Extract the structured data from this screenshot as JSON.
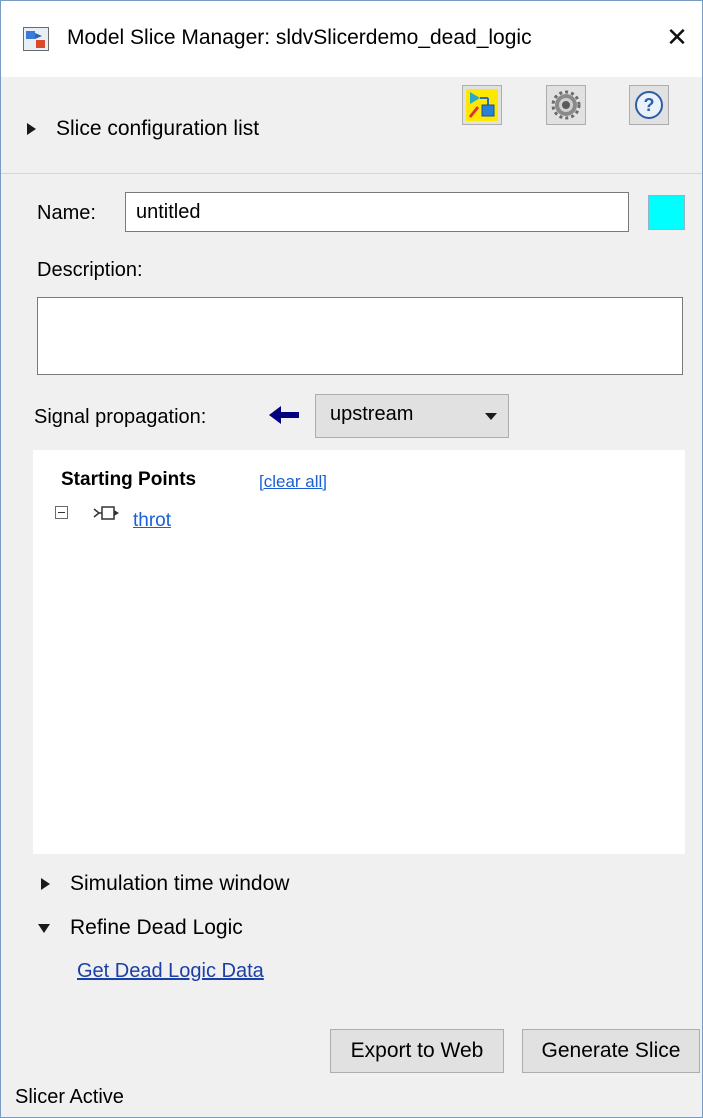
{
  "window": {
    "title": "Model Slice Manager: sldvSlicerdemo_dead_logic",
    "close_glyph": "✕"
  },
  "toolbar": {
    "buttons": [
      {
        "name": "highlight-slice-icon",
        "tooltip": ""
      },
      {
        "name": "gear-icon",
        "tooltip": ""
      },
      {
        "name": "help-icon",
        "tooltip": ""
      }
    ]
  },
  "sections": {
    "slice_config_list": "Slice configuration list",
    "simulation_time_window": "Simulation time window",
    "refine_dead_logic": "Refine Dead Logic"
  },
  "form": {
    "name_label": "Name:",
    "name_value": "untitled",
    "highlight_color": "#00ffff",
    "description_label": "Description:",
    "description_value": "",
    "signal_propagation_label": "Signal propagation:",
    "signal_propagation_value": "upstream"
  },
  "starting_points": {
    "title": "Starting Points",
    "clear_all": "[clear all]",
    "items": [
      {
        "label": "throt"
      }
    ]
  },
  "refine": {
    "get_dead_logic_link": "Get Dead Logic Data"
  },
  "actions": {
    "export_to_web": "Export to Web",
    "generate_slice": "Generate Slice"
  },
  "status_bar": {
    "text": "Slicer Active"
  },
  "colors": {
    "accent_link": "#1a5fd6",
    "arrow": "#000080",
    "swatch": "#00ffff"
  }
}
